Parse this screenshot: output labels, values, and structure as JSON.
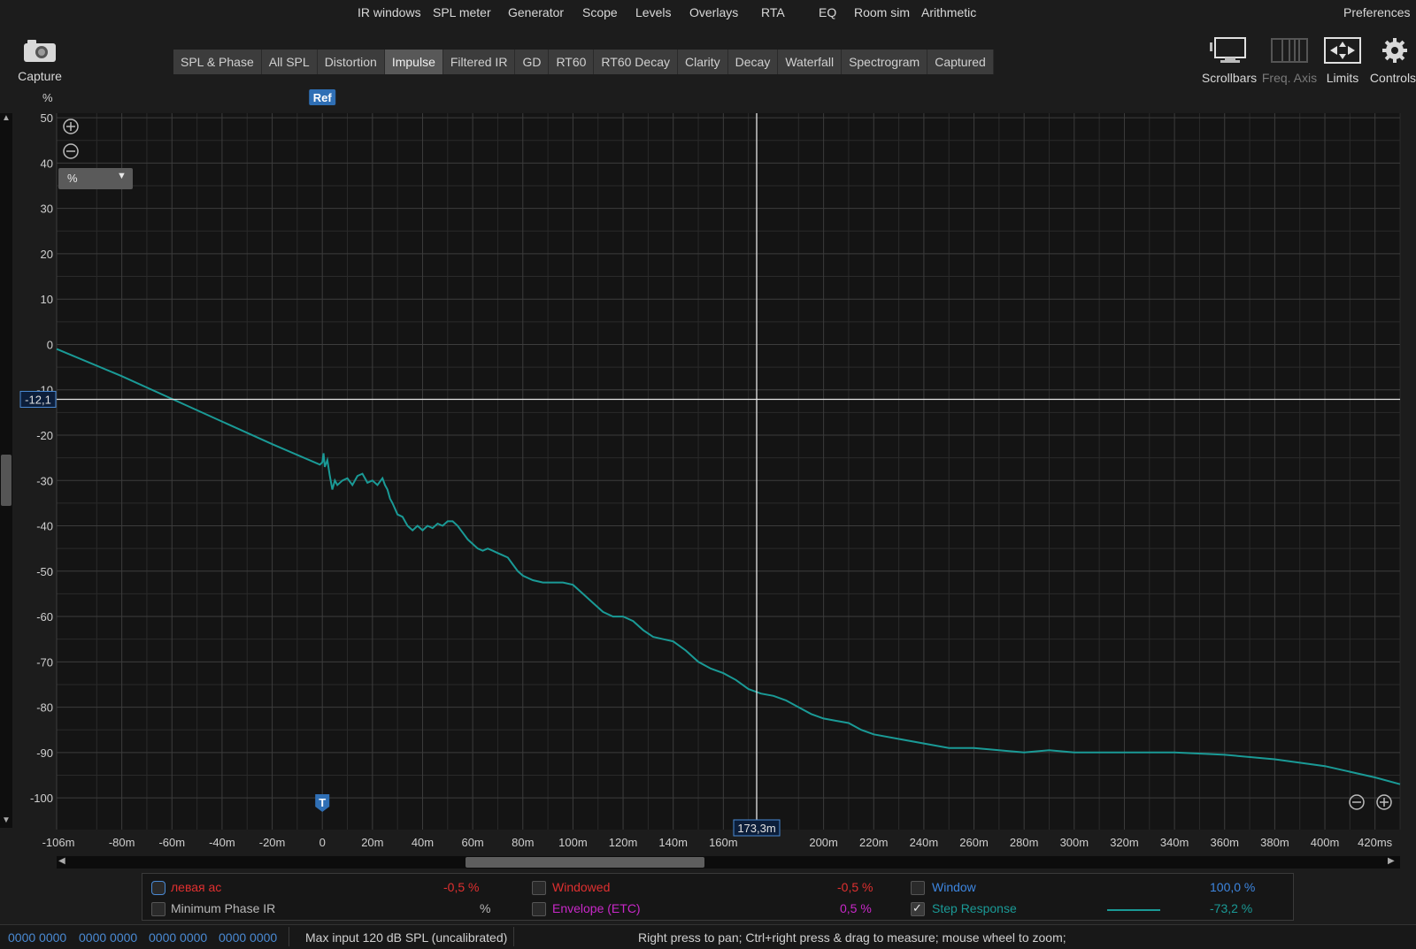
{
  "menu": {
    "items": [
      "IR windows",
      "SPL meter",
      "Generator",
      "Scope",
      "Levels",
      "Overlays",
      "RTA",
      "EQ",
      "Room sim",
      "Arithmetic"
    ],
    "preferences": "Preferences"
  },
  "capture": {
    "label": "Capture"
  },
  "tabs": {
    "items": [
      "SPL & Phase",
      "All SPL",
      "Distortion",
      "Impulse",
      "Filtered IR",
      "GD",
      "RT60",
      "RT60 Decay",
      "Clarity",
      "Decay",
      "Waterfall",
      "Spectrogram",
      "Captured"
    ],
    "active": "Impulse"
  },
  "tools": {
    "scrollbars": "Scrollbars",
    "freq_axis": "Freq. Axis",
    "limits": "Limits",
    "controls": "Controls"
  },
  "plot": {
    "y_unit": "%",
    "ref_label": "Ref",
    "t_label": "T",
    "unit_select": "%",
    "cursor_y_value": "-12,1",
    "cursor_x_value": "173,3m",
    "colors": {
      "trace": "#1a9a96",
      "cursor": "#e6e6e6",
      "grid_major": "#3c3c3c",
      "grid_minor": "#2a2a2a",
      "background": "#141414"
    }
  },
  "chart_data": {
    "type": "line",
    "title": "",
    "xlabel": "",
    "ylabel": "%",
    "xlim": [
      -106,
      430
    ],
    "ylim": [
      -107,
      51
    ],
    "x_ticks": [
      "-106m",
      "-80m",
      "-60m",
      "-40m",
      "-20m",
      "0",
      "20m",
      "40m",
      "60m",
      "80m",
      "100m",
      "120m",
      "140m",
      "160m",
      "200m",
      "220m",
      "240m",
      "260m",
      "280m",
      "300m",
      "320m",
      "340m",
      "360m",
      "380m",
      "400m",
      "420ms"
    ],
    "y_ticks": [
      "50",
      "40",
      "30",
      "20",
      "10",
      "0",
      "-10",
      "-20",
      "-30",
      "-40",
      "-50",
      "-60",
      "-70",
      "-80",
      "-90",
      "-100"
    ],
    "series": [
      {
        "x": [
          -106,
          -80,
          -60,
          -40,
          -20,
          -1,
          0,
          0.5,
          1,
          2,
          3,
          4,
          5,
          6,
          8,
          10,
          12,
          14,
          16,
          18,
          20,
          22,
          24,
          25,
          26,
          27,
          28,
          30,
          32,
          34,
          36,
          38,
          40,
          42,
          44,
          46,
          48,
          50,
          52,
          54,
          56,
          58,
          60,
          62,
          64,
          66,
          68,
          70,
          72,
          74,
          76,
          78,
          80,
          84,
          88,
          92,
          96,
          100,
          104,
          108,
          112,
          116,
          120,
          124,
          128,
          132,
          136,
          140,
          145,
          150,
          155,
          160,
          165,
          170,
          175,
          180,
          185,
          190,
          195,
          200,
          205,
          210,
          215,
          220,
          230,
          240,
          250,
          260,
          270,
          280,
          290,
          300,
          320,
          340,
          360,
          380,
          400,
          420,
          430
        ],
        "y": [
          -1,
          -7,
          -12,
          -17,
          -22,
          -26.5,
          -26,
          -24,
          -27,
          -25.5,
          -29,
          -32,
          -30,
          -31,
          -30,
          -29.5,
          -31,
          -29,
          -28.5,
          -30.5,
          -30,
          -31,
          -29.5,
          -31,
          -32,
          -34,
          -35,
          -37.5,
          -38,
          -40,
          -41,
          -40,
          -41,
          -40,
          -40.5,
          -39.5,
          -40,
          -39,
          -39,
          -40,
          -41.5,
          -43,
          -44,
          -45,
          -45.5,
          -45,
          -45.5,
          -46,
          -46.5,
          -47,
          -48.5,
          -50,
          -51,
          -52,
          -52.5,
          -52.5,
          -52.5,
          -53,
          -55,
          -57,
          -59,
          -60,
          -60,
          -61,
          -63,
          -64.5,
          -65,
          -65.5,
          -67.5,
          -70,
          -71.5,
          -72.5,
          -74,
          -76,
          -77,
          -77.5,
          -78.5,
          -80,
          -81.5,
          -82.5,
          -83,
          -83.5,
          -85,
          -86,
          -87,
          -88,
          -89,
          -89,
          -89.5,
          -90,
          -89.5,
          -90,
          -90,
          -90,
          -90.5,
          -91.5,
          -93,
          -95.5,
          -97
        ]
      }
    ]
  },
  "zoom": {
    "in": "+",
    "out": "-"
  },
  "legend": {
    "row1": [
      {
        "label": "левая ас",
        "value": "-0,5 %",
        "checked": false
      },
      {
        "label": "Windowed",
        "value": "-0,5 %",
        "checked": false
      },
      {
        "label": "Window",
        "value": "100,0 %",
        "checked": false
      }
    ],
    "row2": [
      {
        "label": "Minimum Phase IR",
        "value": "%",
        "checked": false
      },
      {
        "label": "Envelope (ETC)",
        "value": "0,5 %",
        "checked": false
      },
      {
        "label": "Step Response",
        "value": "-73,2 %",
        "checked": true
      }
    ]
  },
  "status": {
    "bits": [
      "0000 0000",
      "0000 0000",
      "0000 0000",
      "0000 0000"
    ],
    "max_input": "Max input 120 dB SPL (uncalibrated)",
    "hint": "Right press to pan; Ctrl+right press & drag to measure; mouse wheel to zoom;"
  }
}
